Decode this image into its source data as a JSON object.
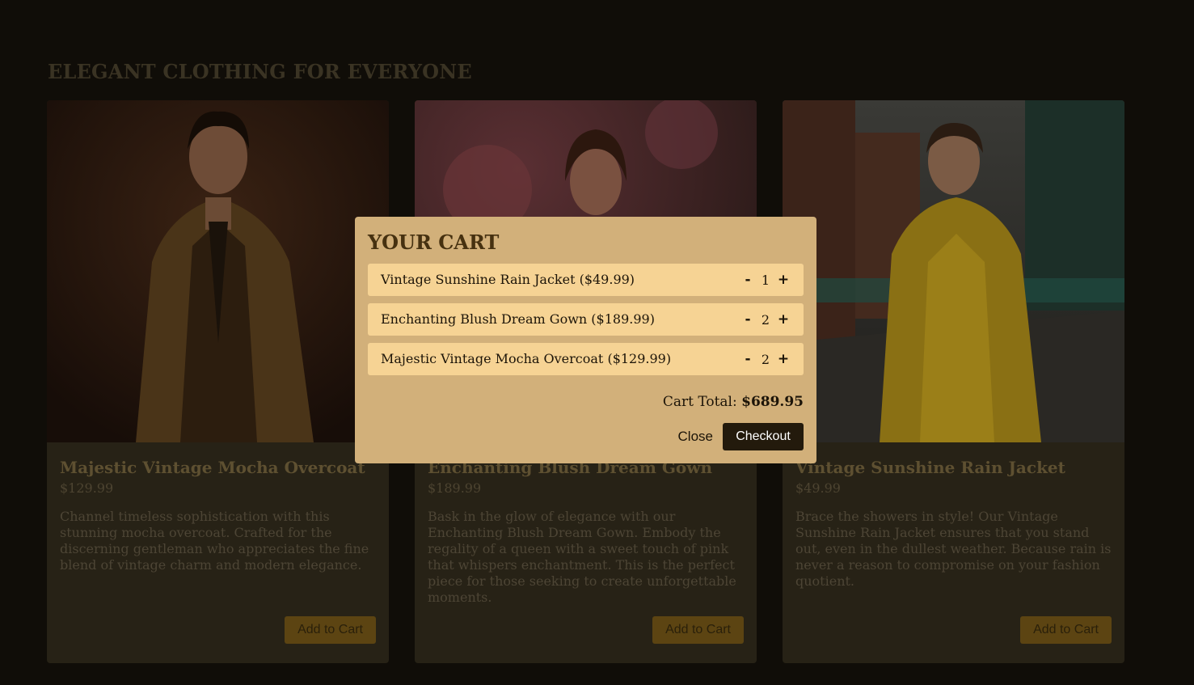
{
  "section": {
    "title": "ELEGANT CLOTHING FOR EVERYONE"
  },
  "products": [
    {
      "title": "Majestic Vintage Mocha Overcoat",
      "price": "$129.99",
      "description": "Channel timeless sophistication with this stunning mocha overcoat. Crafted for the discerning gentleman who appreciates the fine blend of vintage charm and modern elegance.",
      "button": "Add to Cart"
    },
    {
      "title": "Enchanting Blush Dream Gown",
      "price": "$189.99",
      "description": "Bask in the glow of elegance with our Enchanting Blush Dream Gown. Embody the regality of a queen with a sweet touch of pink that whispers enchantment. This is the perfect piece for those seeking to create unforgettable moments.",
      "button": "Add to Cart"
    },
    {
      "title": "Vintage Sunshine Rain Jacket",
      "price": "$49.99",
      "description": "Brace the showers in style! Our Vintage Sunshine Rain Jacket ensures that you stand out, even in the dullest weather. Because rain is never a reason to compromise on your fashion quotient.",
      "button": "Add to Cart"
    }
  ],
  "cart": {
    "title": "YOUR CART",
    "items": [
      {
        "label": "Vintage Sunshine Rain Jacket ($49.99)",
        "qty": "1",
        "minus": "-",
        "plus": "+"
      },
      {
        "label": "Enchanting Blush Dream Gown ($189.99)",
        "qty": "2",
        "minus": "-",
        "plus": "+"
      },
      {
        "label": "Majestic Vintage Mocha Overcoat ($129.99)",
        "qty": "2",
        "minus": "-",
        "plus": "+"
      }
    ],
    "total_label": "Cart Total:",
    "total_value": "$689.95",
    "close_label": "Close",
    "checkout_label": "Checkout"
  },
  "colors": {
    "page_bg": "#100d08",
    "modal_bg": "#d2b07a",
    "cart_item_bg": "#f6d394",
    "checkout_bg": "#231a0c"
  },
  "icons": [
    "product-photo-overcoat",
    "product-photo-gown",
    "product-photo-raincoat"
  ]
}
